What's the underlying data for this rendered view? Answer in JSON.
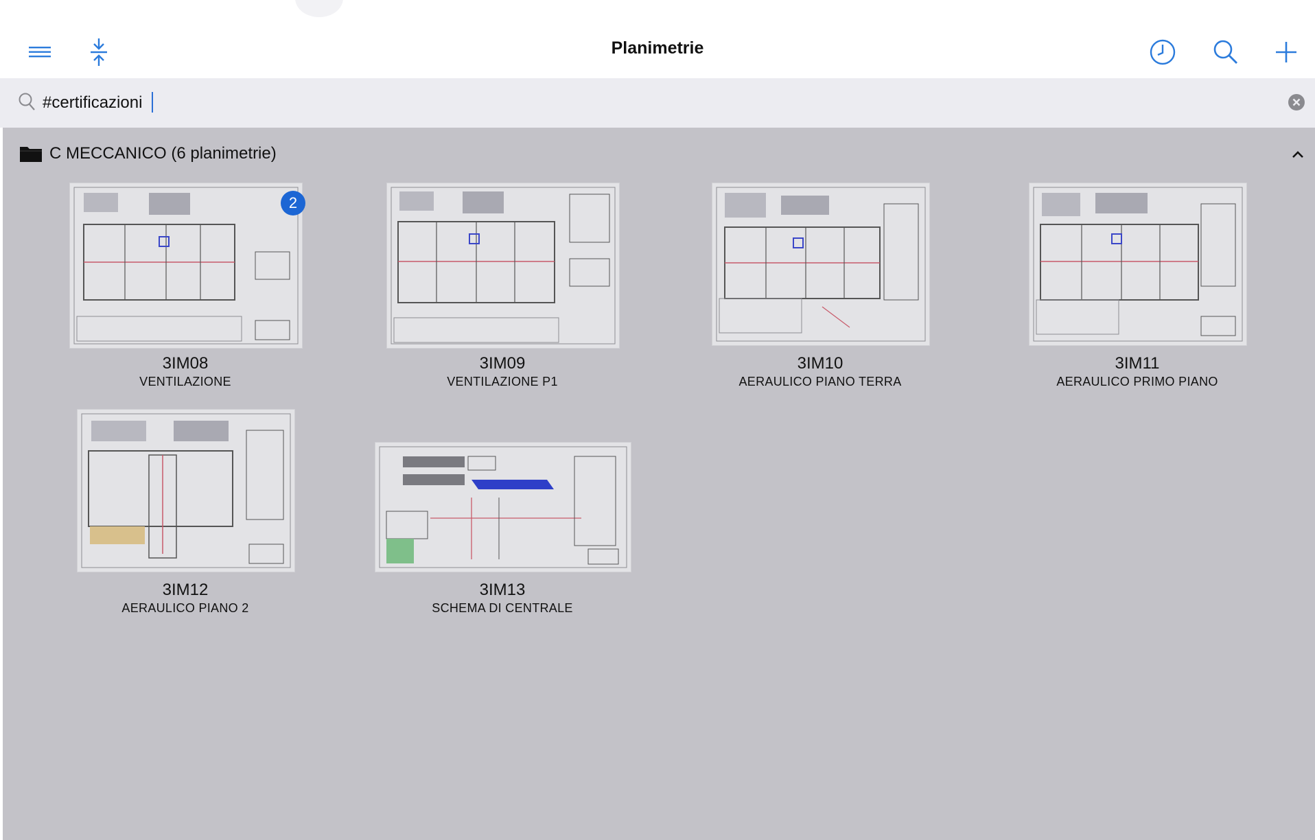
{
  "navbar": {
    "title": "Planimetrie",
    "icons": [
      "menu-icon",
      "compress-icon",
      "clock-icon",
      "search-icon",
      "plus-icon"
    ],
    "accent_color": "#2b7bdc"
  },
  "search": {
    "value": "#certificazioni",
    "placeholder": ""
  },
  "section": {
    "title": "C MECCANICO (6 planimetrie)",
    "expanded": true
  },
  "cards": [
    {
      "code": "3IM08",
      "subtitle": "VENTILAZIONE",
      "badge": "2"
    },
    {
      "code": "3IM09",
      "subtitle": "VENTILAZIONE P1"
    },
    {
      "code": "3IM10",
      "subtitle": "AERAULICO PIANO TERRA"
    },
    {
      "code": "3IM11",
      "subtitle": "AERAULICO PRIMO PIANO"
    },
    {
      "code": "3IM12",
      "subtitle": "AERAULICO PIANO 2"
    },
    {
      "code": "3IM13",
      "subtitle": "SCHEMA DI CENTRALE"
    }
  ],
  "colors": {
    "content_bg": "#c3c2c8",
    "search_bg": "#ececf1",
    "badge": "#1c66d4"
  }
}
